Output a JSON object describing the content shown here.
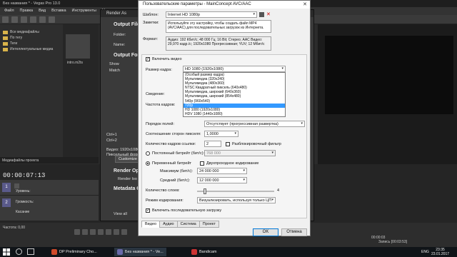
{
  "vegas": {
    "title": "Без названия * - Vegas Pro 13.0",
    "menu": [
      "Файл",
      "Правка",
      "Вид",
      "Вставка",
      "Инструменты",
      "Не"
    ],
    "tree": [
      "Все медиафайлы",
      "По тегу",
      "Теги",
      "Интеллектуальные медиа"
    ],
    "media_file": "intro.m2ts",
    "tab_label": "Медиафайлы проекта",
    "timecode": "00:00:07:13",
    "tracks": [
      {
        "num": "1",
        "label": "Уровень:"
      },
      {
        "num": "2",
        "label": "Громкость:"
      },
      {
        "num": "2",
        "label": "Касание"
      }
    ],
    "rate": "Частота: 0,00",
    "record_status": "Запись [00:03:53]",
    "preview_times": [
      "00:00:03",
      "00:00:09"
    ]
  },
  "render_as": {
    "title": "Render As",
    "output_file": "Output File",
    "folder_label": "Folder:",
    "name_label": "Name:",
    "output_format": "Output Format",
    "customize": "Customize",
    "render_options": "Render Op",
    "render_loop": "Render loo",
    "metadata": "Metadata O",
    "view_all": "View all",
    "video_info": "Видео: 1920x1080x12",
    "pixel_format": "Пиксельный формат",
    "ctrl_items": [
      "Ctrl+1",
      "Ctrl+2"
    ],
    "show": "Show",
    "match": "Match"
  },
  "dialog": {
    "title": "Пользовательские параметры - MainConcept AVC/AAC",
    "template_label": "Шаблон:",
    "template_value": "Internet HD 1080p",
    "notes_label": "Заметки:",
    "notes_value": "Используйте эту настройку, чтобы создать файл MP4 (AVC/AAC) для последовательных загрузок из Интернета.",
    "format_label": "Формат:",
    "format_value": "Аудио: 192 Кбит/с; 48 000 Гц; 16 Bit; Стерео; AAC Видео: 29,970 кадр./с; 1920x1080 Прогрессивная; YUV; 12 Мбит/с",
    "include_video": "Включить видео",
    "frame_size_label": "Размер кадра:",
    "frame_size_value": "HD 1080 (1920x1080)",
    "frame_size_options": [
      "(Особый размер кадра)",
      "Мультимедиа (320x240)",
      "Мультимедиа (480x360)",
      "NTSC Квадратный пиксель (640x480)",
      "Мультимедиа, широкий (640x360)",
      "Мультимедиа, широкий (854x480)",
      "540p (960x540)",
      "720p",
      "HD 1080 (1920x1080)",
      "HDV 1080 (1440x1080)"
    ],
    "selected_index": 7,
    "info_label": "Сведение:",
    "framerate_label": "Частота кадров:",
    "field_order_label": "Порядок полей:",
    "field_order_value": "Отсутствует (прогрессивная развертка)",
    "par_label": "Соотношение сторон пикселя:",
    "par_value": "1,0000",
    "ref_frames_label": "Количество кадров ссылки:",
    "ref_frames_value": "2",
    "deblock_label": "Разблокировочный фильтр",
    "cbr_label": "Постоянный битрейт (бит/с):",
    "cbr_value": "768 000",
    "vbr_label": "Переменный битрейт",
    "two_pass_label": "Двухпроходное кодирование",
    "max_label": "Максимум (бит/с):",
    "max_value": "24 000 000",
    "avg_label": "Средний (бит/с):",
    "avg_value": "12 000 000",
    "slices_label": "Количество слоев:",
    "slices_value": "4",
    "slices_level": 0.08,
    "encode_mode_label": "Режим кодирования:",
    "encode_mode_value": "Визуализировать, используя только ЦП",
    "progressive_label": "Включить последовательную загрузку",
    "tabs": [
      "Видео",
      "Аудио",
      "Система",
      "Проект"
    ],
    "ok": "OK",
    "cancel": "Отмена"
  },
  "taskbar": {
    "items": [
      "DP Preliminary Cho...",
      "Без названия * - Ve...",
      "Bandicam"
    ],
    "lang": "ENG",
    "time": "23:35",
    "date": "23.01.2017"
  },
  "colors": {
    "selection": "#3399ff",
    "dialog_bg": "#f0f0f0",
    "vegas_bg": "#2b2b2b"
  }
}
